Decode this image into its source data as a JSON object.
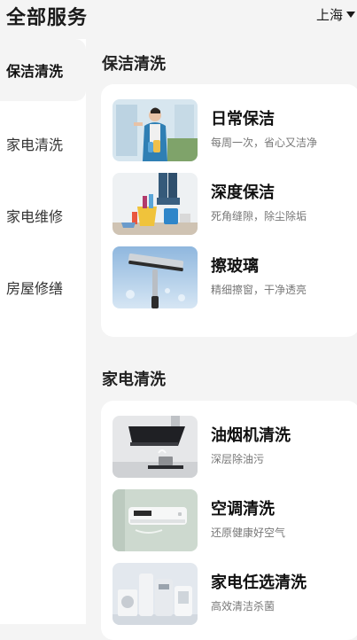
{
  "header": {
    "title": "全部服务",
    "city": "上海"
  },
  "sidebar": {
    "items": [
      {
        "label": "保洁清洗",
        "active": true
      },
      {
        "label": "家电清洗",
        "active": false
      },
      {
        "label": "家电维修",
        "active": false
      },
      {
        "label": "房屋修缮",
        "active": false
      }
    ]
  },
  "sections": [
    {
      "title": "保洁清洗",
      "services": [
        {
          "name": "日常保洁",
          "desc": "每周一次，省心又洁净",
          "icon": "cleaning-staff-photo"
        },
        {
          "name": "深度保洁",
          "desc": "死角缝隙，除尘除垢",
          "icon": "cleaning-tools-photo"
        },
        {
          "name": "擦玻璃",
          "desc": "精细擦窗，干净透亮",
          "icon": "window-squeegee-photo"
        }
      ]
    },
    {
      "title": "家电清洗",
      "services": [
        {
          "name": "油烟机清洗",
          "desc": "深层除油污",
          "icon": "range-hood-photo"
        },
        {
          "name": "空调清洗",
          "desc": "还原健康好空气",
          "icon": "air-conditioner-photo"
        },
        {
          "name": "家电任选清洗",
          "desc": "高效清洁杀菌",
          "icon": "appliances-photo"
        }
      ]
    }
  ]
}
